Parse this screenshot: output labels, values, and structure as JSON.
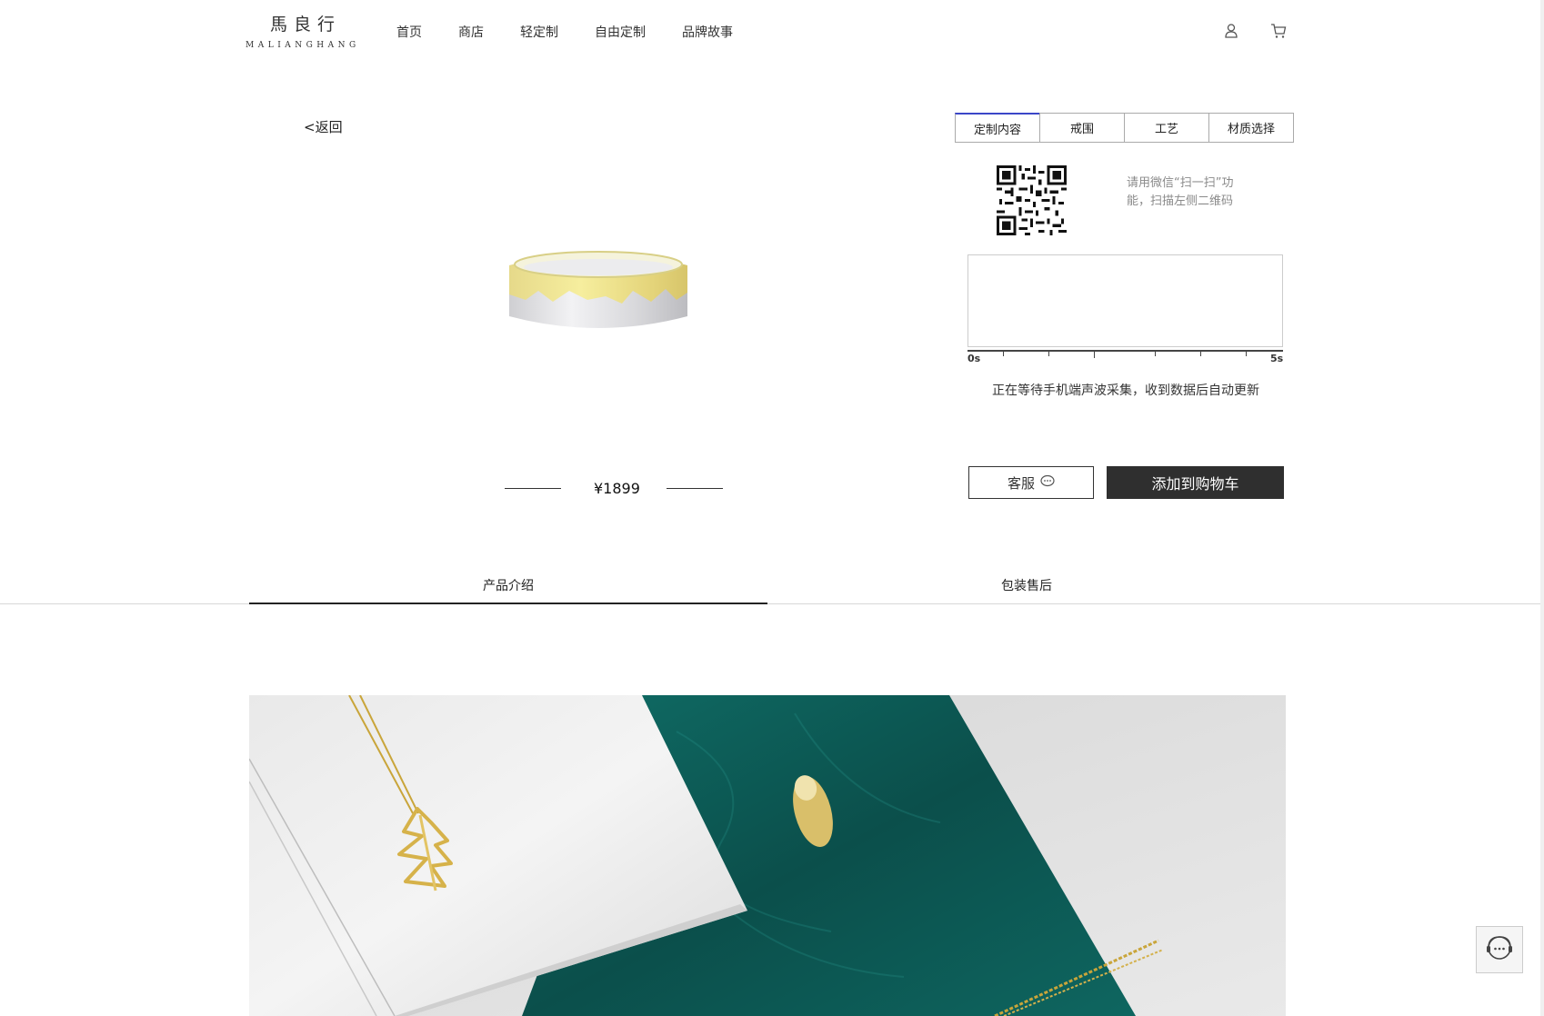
{
  "brand": {
    "name_cn": "馬良行",
    "name_en": "MALIANGHANG"
  },
  "nav": {
    "items": [
      "首页",
      "商店",
      "轻定制",
      "自由定制",
      "品牌故事"
    ]
  },
  "header_icons": [
    "user-icon",
    "cart-icon"
  ],
  "back_label": "<返回",
  "product": {
    "price": "¥1899"
  },
  "custom_tabs": [
    "定制内容",
    "戒围",
    "工艺",
    "材质选择"
  ],
  "qr_hint": "请用微信“扫一扫”功能，扫描左侧二维码",
  "recorder": {
    "start_label": "0s",
    "end_label": "5s",
    "status": "正在等待手机端声波采集，收到数据后自动更新"
  },
  "buttons": {
    "service": "客服",
    "add_to_cart": "添加到购物车"
  },
  "detail_tabs": [
    "产品介绍",
    "包装售后"
  ],
  "colors": {
    "accent_tab": "#3b46c8",
    "cart_button": "#2f2f2f",
    "marble_green": "#0d5a55"
  }
}
